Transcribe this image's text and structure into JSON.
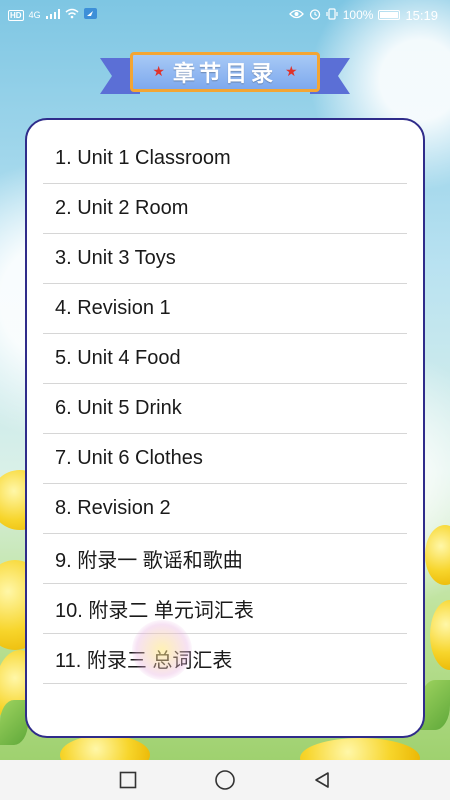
{
  "status_bar": {
    "hd": "HD",
    "signal": "4G",
    "battery": "100%",
    "time": "15:19"
  },
  "title": {
    "text": "章节目录",
    "star": "★"
  },
  "chapters": [
    {
      "label": "1. Unit 1 Classroom"
    },
    {
      "label": "2. Unit 2 Room"
    },
    {
      "label": "3. Unit 3 Toys"
    },
    {
      "label": "4. Revision 1"
    },
    {
      "label": "5. Unit 4 Food"
    },
    {
      "label": "6. Unit 5 Drink"
    },
    {
      "label": "7. Unit 6 Clothes"
    },
    {
      "label": "8. Revision 2"
    },
    {
      "label": "9. 附录一 歌谣和歌曲"
    },
    {
      "label": "10. 附录二 单元词汇表"
    },
    {
      "label": "11. 附录三 总词汇表"
    }
  ],
  "nav_bar": {
    "icons": [
      "square-recents-icon",
      "circle-home-icon",
      "triangle-back-icon"
    ]
  },
  "colors": {
    "card_border": "#2f2c8a",
    "ribbon_border": "#f3a533",
    "ribbon_fill": "#7ea9ee",
    "star": "#e0322b"
  }
}
